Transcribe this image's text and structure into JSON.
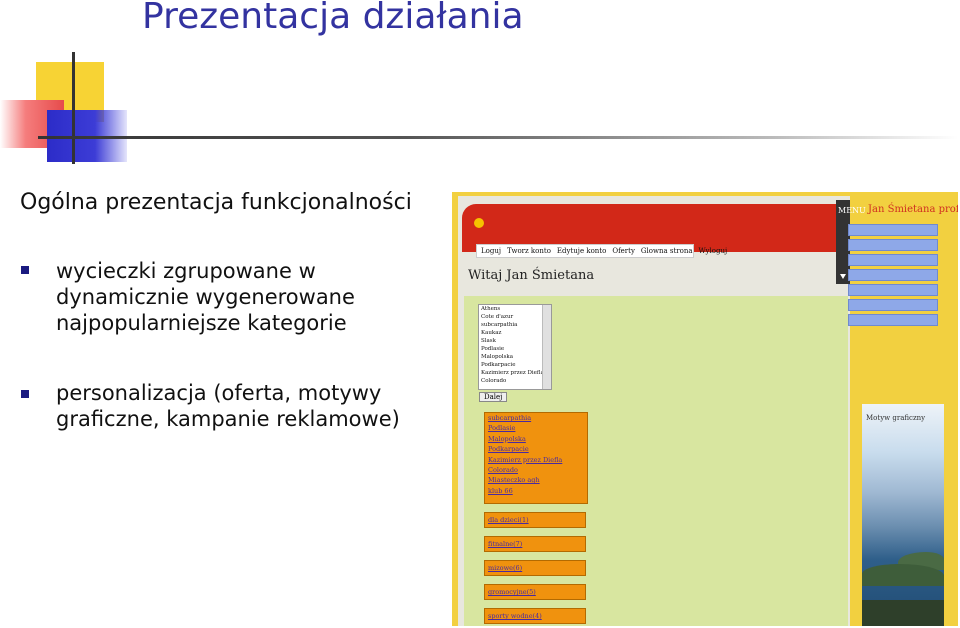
{
  "slide": {
    "title": "Prezentacja działania",
    "subtitle": "Ogólna prezentacja funkcjonalności",
    "bullets": [
      "wycieczki zgrupowane w\ndynamicznie wygenerowane\nnajpopularniejsze kategorie",
      "personalizacja (oferta, motywy\ngraficzne, kampanie reklamowe)"
    ]
  },
  "screenshot": {
    "nav": [
      "Loguj",
      "Tworz konto",
      "Edytuje konto",
      "Oferty",
      "Glowna strona",
      "Wyloguj"
    ],
    "side_menu_label": "MENU",
    "welcome": "Witaj Jan Śmietana",
    "region_options": [
      "Athens",
      "Cote d'azur",
      "subcarpathia",
      "Kaukaz",
      "Slask",
      "Podlasie",
      "Malopolska",
      "Podkarpacie",
      "Kazimierz przez Diefla",
      "Colorado"
    ],
    "dalej_label": "Dalej",
    "orange_links": [
      "subcarpathia",
      "Podlasie",
      "Malopolska",
      "Podkarpacie",
      "Kazimierz przez Diefla",
      "Colorado",
      "Miasteczko agh",
      "klub 66"
    ],
    "categories": [
      "dla dzieci(1)",
      "fitnalne(7)",
      "mizowe(6)",
      "gromocyjne(5)",
      "sporty wodne(4)"
    ],
    "profile_title": "Jan Śmietana profil",
    "motif_label": "Motyw graficzny"
  }
}
